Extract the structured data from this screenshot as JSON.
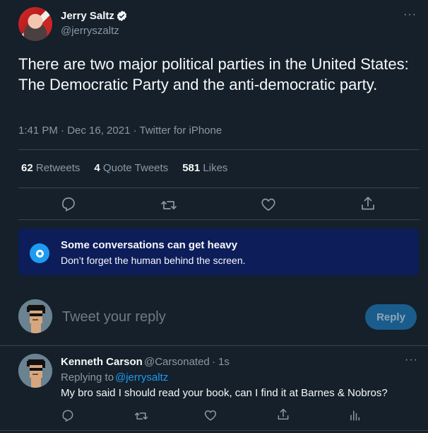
{
  "tweet": {
    "author_name": "Jerry Saltz",
    "author_handle": "@jerryszaltz",
    "text": "There are two major political parties in the United States: The  Democratic Party and the anti-democratic party.",
    "meta": "1:41 PM · Dec 16, 2021 · Twitter for iPhone",
    "stats": [
      {
        "count": "62",
        "label": "Retweets"
      },
      {
        "count": "4",
        "label": "Quote Tweets"
      },
      {
        "count": "581",
        "label": "Likes"
      }
    ],
    "actions": [
      "reply-icon",
      "retweet-icon",
      "like-icon",
      "share-icon"
    ]
  },
  "notice": {
    "title": "Some conversations can get heavy",
    "subtitle": "Don’t forget the human behind the screen."
  },
  "composer": {
    "placeholder": "Tweet your reply",
    "button_label": "Reply"
  },
  "reply": {
    "name": "Kenneth Carson",
    "handle": "@Carsonated",
    "dot": "·",
    "time": "1s",
    "replying_prefix": "Replying to",
    "replying_to": "@jerrysaltz",
    "text": "My bro said I should read your book, can I find it at Barnes & Nobros?",
    "actions": [
      "reply-icon",
      "retweet-icon",
      "like-icon",
      "share-icon",
      "analytics-icon"
    ]
  },
  "ui": {
    "more": "···"
  },
  "colors": {
    "background": "#15202b",
    "accent": "#1d9bf0",
    "notice_bg": "#0c1d5a",
    "muted": "#8b98a5"
  }
}
